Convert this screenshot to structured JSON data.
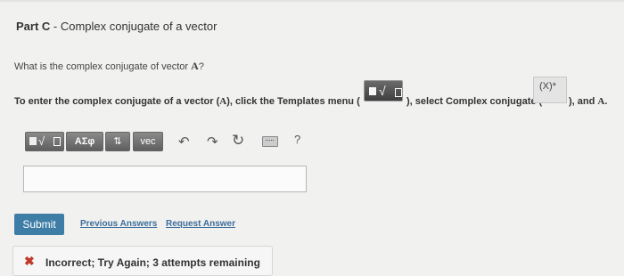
{
  "part": {
    "label": "Part C",
    "separator": " - ",
    "title": "Complex conjugate of a vector"
  },
  "question": {
    "text": "What is the complex conjugate of vector ",
    "vector": "A",
    "suffix": "?"
  },
  "instruction": {
    "part1": "To enter the complex conjugate of a vector (",
    "vector": "A",
    "part2": "), click the Templates menu (",
    "part3": "), select Complex conjugate (",
    "conj_label": "(X)*",
    "part4": "), and ",
    "end_vector": "A",
    "end_period": "."
  },
  "toolbar": {
    "templates_radical": "√",
    "greek_label": "ΑΣφ",
    "arrows_label": "⇅",
    "vec_label": "vec",
    "undo_glyph": "↶",
    "redo_glyph": "↷",
    "reset_glyph": "↻",
    "help_label": "?"
  },
  "answer": {
    "value": ""
  },
  "actions": {
    "submit_label": "Submit",
    "previous_answers_label": "Previous Answers",
    "request_answer_label": "Request Answer"
  },
  "feedback": {
    "icon_glyph": "✖",
    "text": "Incorrect; Try Again; 3 attempts remaining",
    "icon_color": "#c0392b"
  }
}
